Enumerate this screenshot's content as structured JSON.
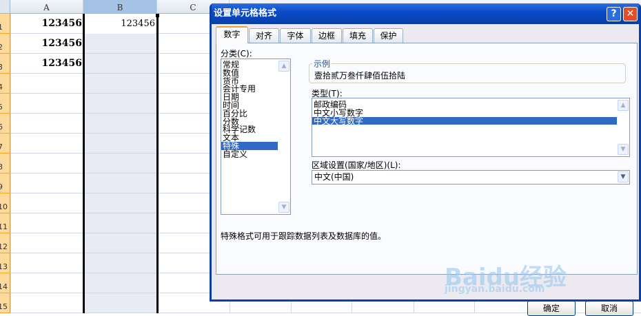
{
  "sheet": {
    "columns": [
      "A",
      "B",
      "C"
    ],
    "rows": [
      "1",
      "2",
      "3",
      "4",
      "5",
      "6",
      "7",
      "8",
      "9",
      "10",
      "11",
      "12",
      "13",
      "14",
      "15"
    ],
    "cells": {
      "A1": "123456",
      "A2": "123456",
      "A3": "123456",
      "B1": "123456"
    }
  },
  "dialog": {
    "title": "设置单元格格式",
    "help": "?",
    "close": "✕",
    "tabs": [
      "数字",
      "对齐",
      "字体",
      "边框",
      "填充",
      "保护"
    ],
    "category_label": "分类(C):",
    "categories": [
      "常规",
      "数值",
      "货币",
      "会计专用",
      "日期",
      "时间",
      "百分比",
      "分数",
      "科学记数",
      "文本",
      "特殊",
      "自定义"
    ],
    "selected_category": "特殊",
    "sample_label": "示例",
    "sample_value": "壹拾贰万叁仟肆佰伍拾陆",
    "type_label": "类型(T):",
    "types": [
      "邮政编码",
      "中文小写数字",
      "中文大写数字"
    ],
    "selected_type": "中文大写数字",
    "locale_label": "区域设置(国家/地区)(L):",
    "locale_value": "中文(中国)",
    "description": "特殊格式可用于跟踪数据列表及数据库的值。",
    "ok": "确定",
    "cancel": "取消"
  },
  "watermark": {
    "text": "Baidu经验",
    "sub": "jingyan.baidu.com"
  },
  "colors": {
    "selection": "#316ac5",
    "title": "#0a3fa8",
    "row_header": "#fdd99b"
  }
}
